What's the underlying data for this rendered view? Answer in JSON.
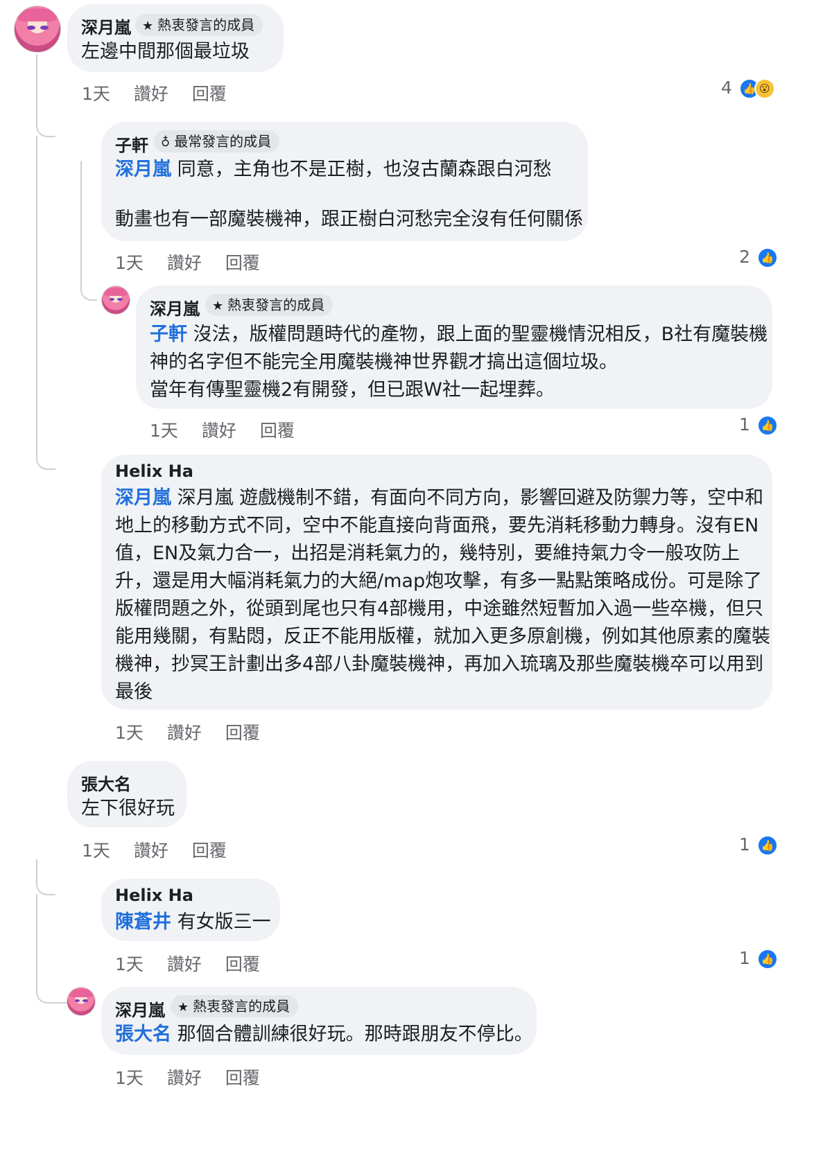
{
  "comments": [
    {
      "author": "深月嵐",
      "badge": "熱衷發言的成員",
      "text_lines": [
        "左邊中間那個最垃圾"
      ],
      "time": "1天",
      "like_label": "讚好",
      "reply_label": "回覆",
      "reaction_count": "4",
      "replies": [
        {
          "author": "子軒",
          "badge": "最常發言的成員",
          "mention": "深月嵐",
          "text_lines": [
            "同意，主角也不是正樹，也沒古蘭森跟白河愁",
            "",
            "動畫也有一部魔裝機神，跟正樹白河愁完全沒有任何關係"
          ],
          "time": "1天",
          "like_label": "讚好",
          "reply_label": "回覆",
          "reaction_count": "2"
        },
        {
          "author": "深月嵐",
          "badge": "熱衷發言的成員",
          "mention": "子軒",
          "text_lines": [
            "沒法，版權問題時代的產物，跟上面的聖靈機情況相反，B社有魔裝機",
            "神的名字但不能完全用魔裝機神世界觀才搞出這個垃圾。",
            "當年有傳聖靈機2有開發，但已跟W社一起埋葬。"
          ],
          "time": "1天",
          "like_label": "讚好",
          "reply_label": "回覆",
          "reaction_count": "1"
        },
        {
          "author": "Helix Ha",
          "mention": "深月嵐",
          "text_lines": [
            "深月嵐 遊戲機制不錯，有面向不同方向，影響回避及防禦力等，空中和",
            "地上的移動方式不同，空中不能直接向背面飛，要先消耗移動力轉身。沒有EN",
            "值，EN及氣力合一，出招是消耗氣力的，幾特別，要維持氣力令一般攻防上",
            "升，還是用大幅消耗氣力的大絕/map炮攻擊，有多一點點策略成份。可是除了",
            "版權問題之外，從頭到尾也只有4部機用，中途雖然短暫加入過一些卒機，但只",
            "能用幾關，有點悶，反正不能用版權，就加入更多原創機，例如其他原素的魔裝",
            "機神，抄冥王計劃出多4部八卦魔裝機神，再加入琉璃及那些魔裝機卒可以用到",
            "最後"
          ],
          "time": "1天",
          "like_label": "讚好",
          "reply_label": "回覆"
        }
      ]
    },
    {
      "author": "張大名",
      "text_lines": [
        "左下很好玩"
      ],
      "time": "1天",
      "like_label": "讚好",
      "reply_label": "回覆",
      "reaction_count": "1",
      "replies": [
        {
          "author": "Helix Ha",
          "mention": "陳蒼井",
          "text_lines": [
            "有女版三一"
          ],
          "time": "1天",
          "like_label": "讚好",
          "reply_label": "回覆",
          "reaction_count": "1"
        },
        {
          "author": "深月嵐",
          "badge": "熱衷發言的成員",
          "mention": "張大名",
          "text_lines": [
            "那個合體訓練很好玩。那時跟朋友不停比。"
          ],
          "time": "1天",
          "like_label": "讚好",
          "reply_label": "回覆"
        }
      ]
    }
  ],
  "icons": {
    "star": "star-icon",
    "medal": "medal-icon",
    "like": "like-reaction-icon",
    "wow": "wow-reaction-icon"
  },
  "colors": {
    "mention": "#216fdb",
    "bubble": "#f0f2f5",
    "like": "#1877f2",
    "muted": "#65676b"
  }
}
